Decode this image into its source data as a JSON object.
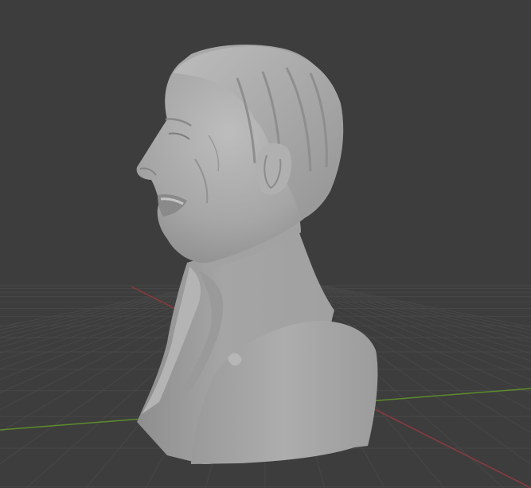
{
  "viewport": {
    "background_color": "#3d3d3d",
    "grid_color": "#464646",
    "x_axis_color": "#8a3a3e",
    "y_axis_color": "#5c8c2c",
    "object_color": "#a8a8a8",
    "object": "bust-sculpture",
    "view": "perspective-side"
  }
}
